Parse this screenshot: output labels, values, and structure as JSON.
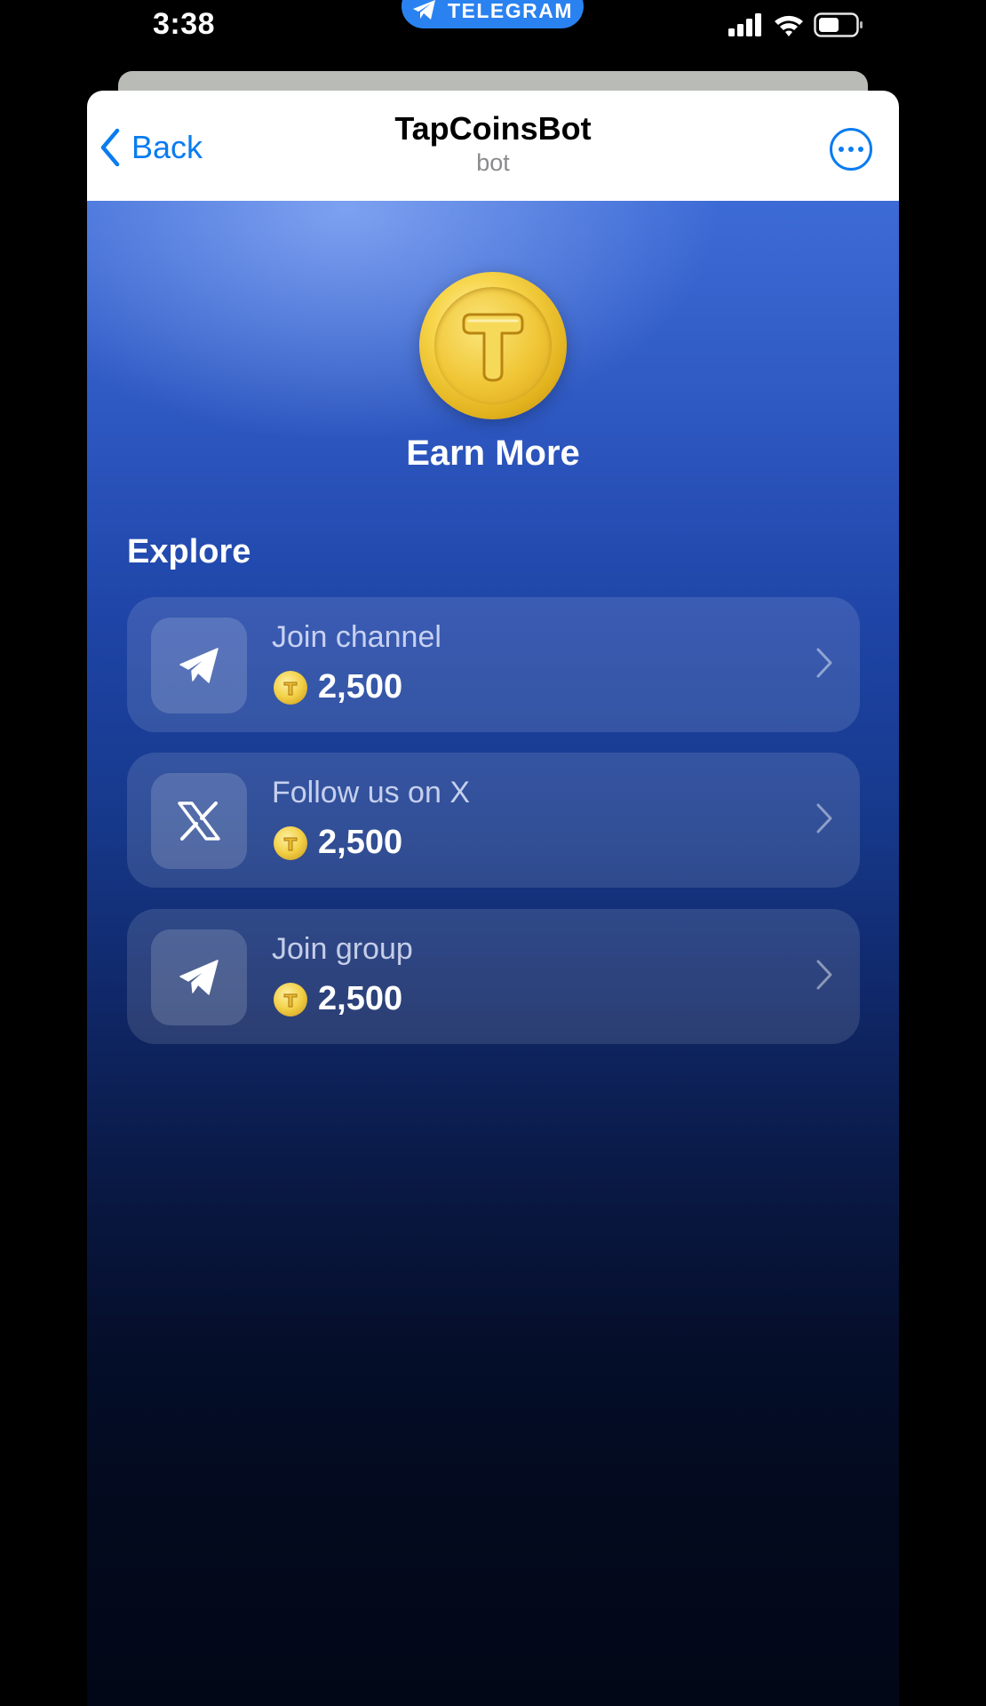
{
  "status_bar": {
    "time": "3:38",
    "pill_label": "TELEGRAM",
    "pill_icon": "telegram-plane-icon",
    "icons": [
      "cellular-signal-icon",
      "wifi-icon",
      "battery-icon"
    ]
  },
  "header": {
    "back_label": "Back",
    "title": "TapCoinsBot",
    "subtitle": "bot",
    "more_icon": "more-options-icon"
  },
  "hero": {
    "coin_icon": "tapcoin-logo-icon",
    "title": "Earn More"
  },
  "explore": {
    "title": "Explore",
    "tasks": [
      {
        "label": "Join channel",
        "reward": "2,500",
        "icon": "telegram-plane-icon"
      },
      {
        "label": "Follow us on X",
        "reward": "2,500",
        "icon": "x-logo-icon"
      },
      {
        "label": "Join group",
        "reward": "2,500",
        "icon": "telegram-plane-icon"
      }
    ]
  },
  "colors": {
    "accent": "#0a7cf0",
    "pill": "#2a82f0",
    "coin_gold": "#f0c636",
    "bg_top": "#3d6bd6",
    "bg_bottom": "#020717"
  }
}
